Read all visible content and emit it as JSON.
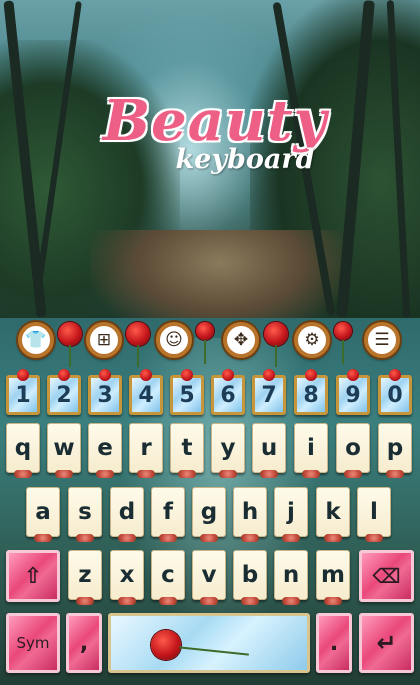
{
  "header": {
    "title": "Beauty",
    "subtitle": "keyboard"
  },
  "toolbar": {
    "icons": [
      "shirt-icon",
      "grid-icon",
      "emoji-icon",
      "move-icon",
      "gear-icon",
      "list-icon"
    ],
    "glyphs": [
      "👕",
      "⊞",
      "☺",
      "✥",
      "⚙",
      "☰"
    ]
  },
  "keyboard": {
    "numbers": [
      "1",
      "2",
      "3",
      "4",
      "5",
      "6",
      "7",
      "8",
      "9",
      "0"
    ],
    "row1": [
      "q",
      "w",
      "e",
      "r",
      "t",
      "y",
      "u",
      "i",
      "o",
      "p"
    ],
    "row2": [
      "a",
      "s",
      "d",
      "f",
      "g",
      "h",
      "j",
      "k",
      "l"
    ],
    "row3": [
      "z",
      "x",
      "c",
      "v",
      "b",
      "n",
      "m"
    ],
    "shift_glyph": "⇧",
    "backspace_glyph": "⌫",
    "sym_label": "Sym",
    "comma_label": ",",
    "period_label": ".",
    "enter_glyph": "↵"
  },
  "colors": {
    "title_pink": "#ee5f86",
    "key_cream": "#f6ecce",
    "special_pink": "#e9487a",
    "number_blue": "#9fd3f0",
    "frame_gold": "#c8963a"
  }
}
